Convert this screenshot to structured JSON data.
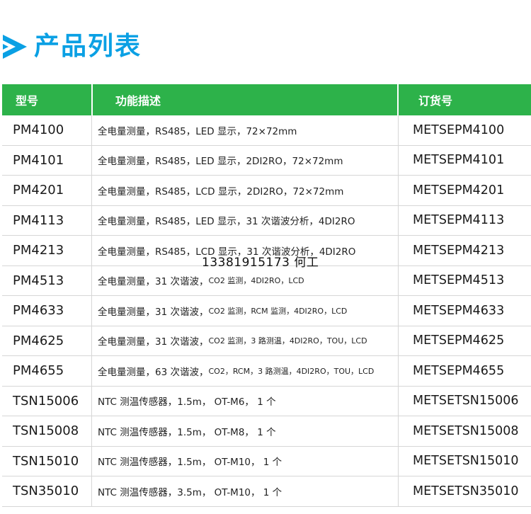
{
  "title": "产品列表",
  "colors": {
    "title": "#0aa0e4",
    "header_bg": "#2db24a"
  },
  "header": {
    "model": "型号",
    "desc": "功能描述",
    "order": "订货号"
  },
  "rows": [
    {
      "model": "PM4100",
      "desc": "全电量测量，RS485，LED 显示，72×72mm",
      "desc_small": "",
      "order": "METSEPM4100"
    },
    {
      "model": "PM4101",
      "desc": "全电量测量，RS485，LED 显示，2DI2RO，72×72mm",
      "desc_small": "",
      "order": "METSEPM4101"
    },
    {
      "model": "PM4201",
      "desc": "全电量测量，RS485，LCD 显示，2DI2RO，72×72mm",
      "desc_small": "",
      "order": "METSEPM4201"
    },
    {
      "model": "PM4113",
      "desc": "全电量测量，RS485，LED 显示，31 次谐波分析，4DI2RO",
      "desc_small": "",
      "order": "METSEPM4113"
    },
    {
      "model": "PM4213",
      "desc": "全电量测量，RS485，LCD 显示，31 次谐波分析，4DI2RO",
      "desc_small": "",
      "order": "METSEPM4213"
    },
    {
      "model": "PM4513",
      "desc": "全电量测量，31 次谐波，",
      "desc_small": "CO2 监测，4DI2RO，LCD",
      "order": "METSEPM4513"
    },
    {
      "model": "PM4633",
      "desc": "全电量测量，31 次谐波，",
      "desc_small": "CO2 监测，RCM 监测，4DI2RO，LCD",
      "order": "METSEPM4633"
    },
    {
      "model": "PM4625",
      "desc": "全电量测量，31 次谐波，",
      "desc_small": "CO2 监测，3 路测温，4DI2RO，TOU，LCD",
      "order": "METSEPM4625"
    },
    {
      "model": "PM4655",
      "desc": "全电量测量，63 次谐波，",
      "desc_small": "CO2，RCM，3 路测温，4DI2RO，TOU，LCD",
      "order": "METSEPM4655"
    },
    {
      "model": "TSN15006",
      "desc": "NTC 测温传感器，1.5m， OT-M6， 1 个",
      "desc_small": "",
      "order": "METSETSN15006"
    },
    {
      "model": "TSN15008",
      "desc": "NTC 测温传感器，1.5m， OT-M8， 1 个",
      "desc_small": "",
      "order": "METSETSN15008"
    },
    {
      "model": "TSN15010",
      "desc": "NTC 测温传感器，1.5m， OT-M10， 1 个",
      "desc_small": "",
      "order": "METSETSN15010"
    },
    {
      "model": "TSN35010",
      "desc": "NTC 测温传感器，3.5m， OT-M10， 1 个",
      "desc_small": "",
      "order": "METSETSN35010"
    }
  ],
  "watermark": "13381915173 何工"
}
